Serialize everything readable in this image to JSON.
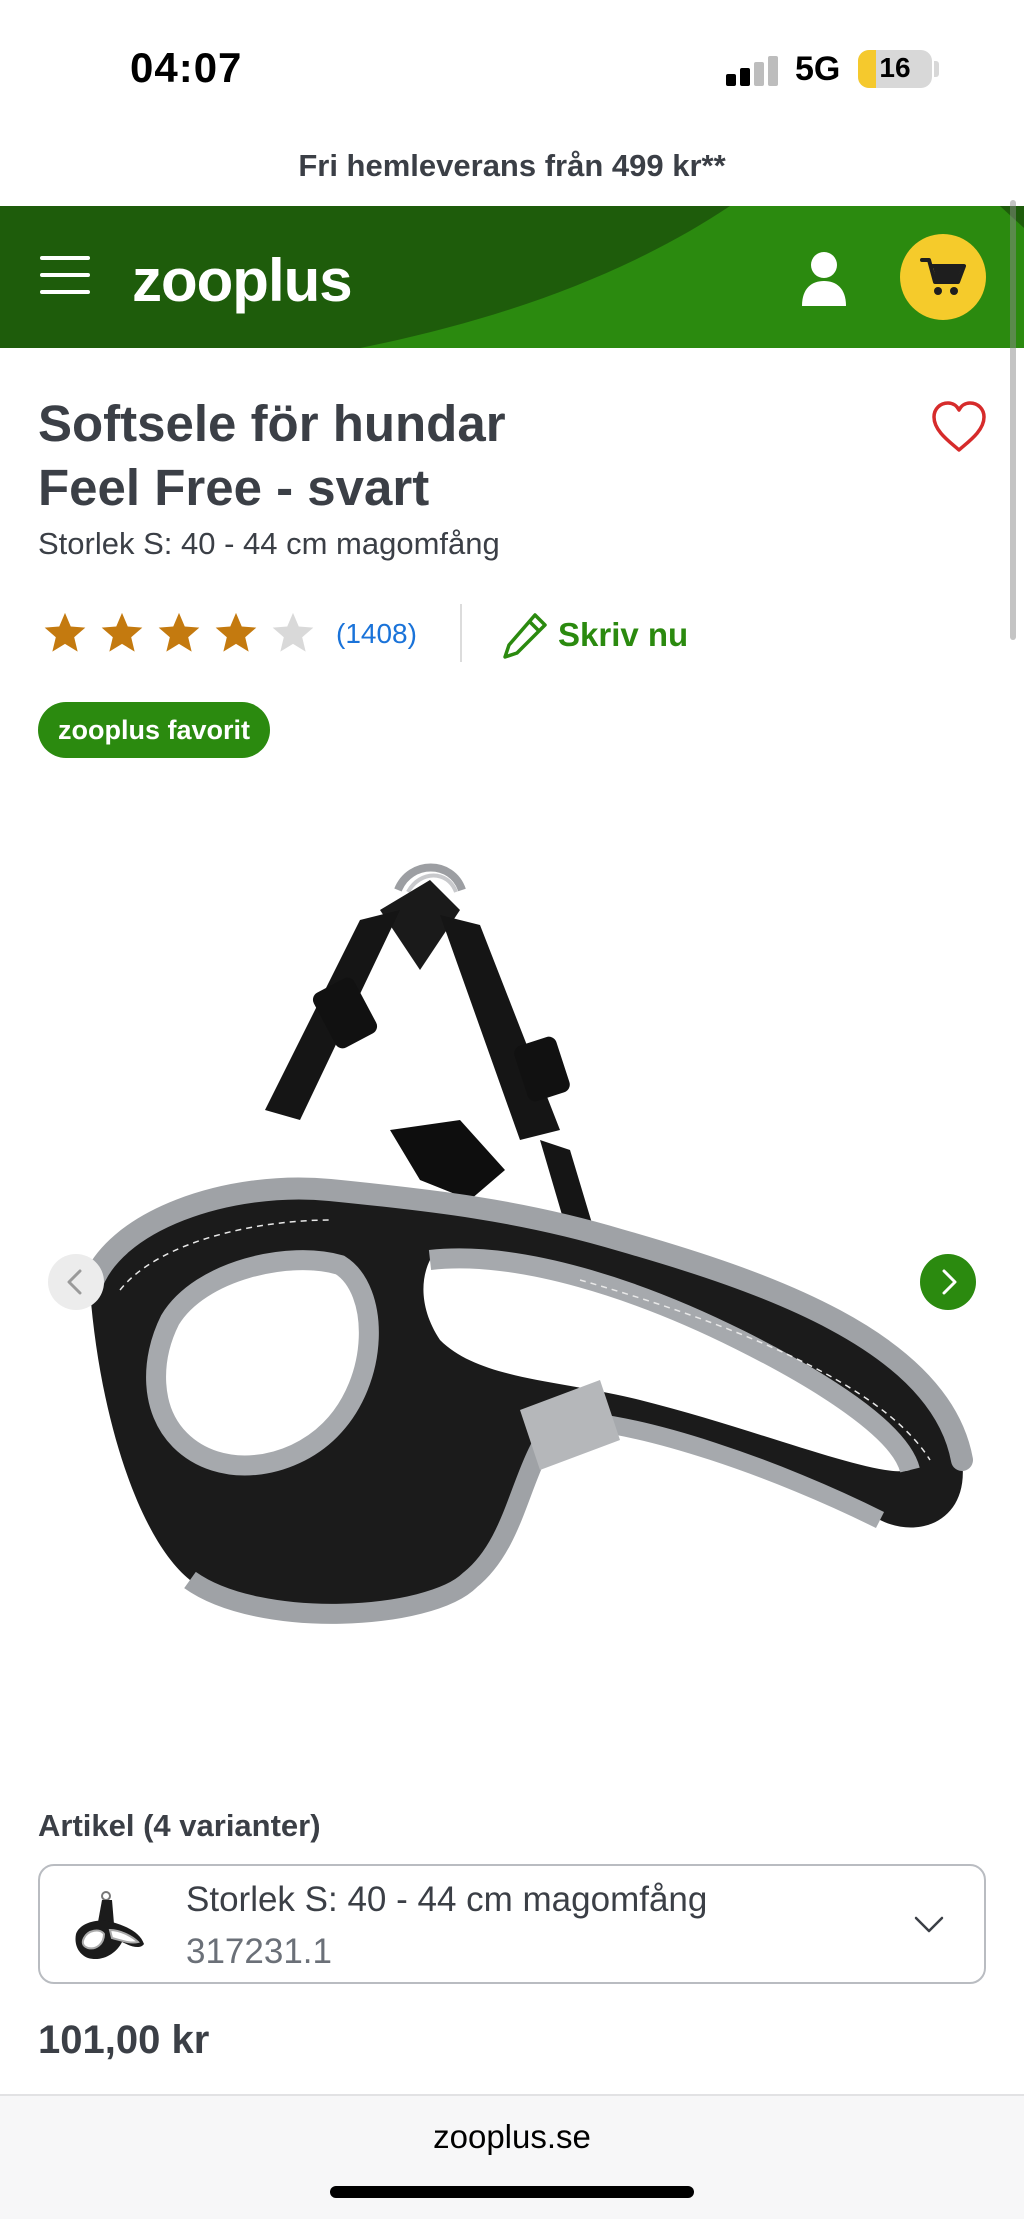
{
  "status_bar": {
    "time": "04:07",
    "network": "5G",
    "battery": "16"
  },
  "promo": {
    "text": "Fri hemleverans från 499 kr**"
  },
  "header": {
    "logo": "zooplus",
    "brand_color": "#2b8a0f",
    "dark_green": "#1e5c0b",
    "cart_color": "#f5cb2b"
  },
  "product": {
    "title_line1": "Softsele för hundar",
    "title_line2": "Feel Free - svart",
    "subtitle": "Storlek S: 40 - 44 cm magomfång",
    "rating": 4,
    "rating_max": 5,
    "review_count": "(1408)",
    "write_review": "Skriv nu",
    "badge": "zooplus favorit"
  },
  "variant": {
    "heading": "Artikel (4 varianter)",
    "selected_name": "Storlek S: 40 - 44 cm magomfång",
    "selected_code": "317231.1"
  },
  "price": "101,00 kr",
  "browser": {
    "url": "zooplus.se"
  },
  "icons": {
    "menu": "hamburger-icon",
    "account": "user-icon",
    "cart": "cart-icon",
    "wishlist": "heart-icon",
    "write": "pencil-icon",
    "prev": "chevron-left-icon",
    "next": "chevron-right-icon",
    "dropdown": "chevron-down-icon"
  },
  "colors": {
    "star_filled": "#c47a0f",
    "star_empty": "#d9d9d9",
    "link": "#1a73d9",
    "wishlist": "#d62b2b"
  }
}
